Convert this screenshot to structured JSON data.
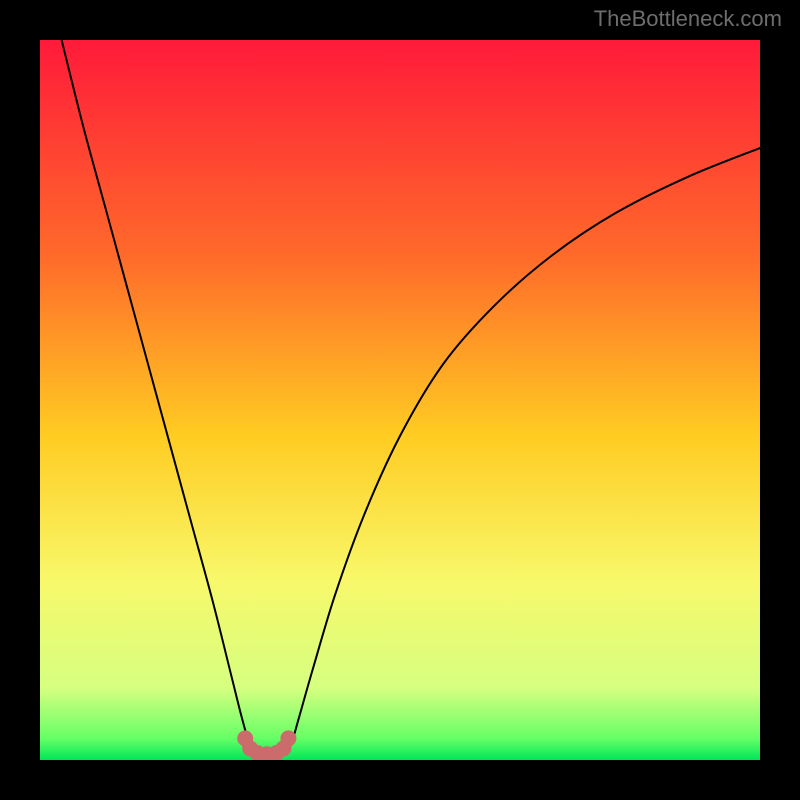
{
  "watermark": "TheBottleneck.com",
  "chart_data": {
    "type": "line",
    "title": "",
    "xlabel": "",
    "ylabel": "",
    "xlim": [
      0,
      100
    ],
    "ylim": [
      0,
      100
    ],
    "background": {
      "type": "vertical-gradient",
      "stops": [
        {
          "pos": 0,
          "color": "#ff1a3a"
        },
        {
          "pos": 30,
          "color": "#ff6a2a"
        },
        {
          "pos": 55,
          "color": "#ffcc22"
        },
        {
          "pos": 75,
          "color": "#f8f86a"
        },
        {
          "pos": 90,
          "color": "#d6ff80"
        },
        {
          "pos": 97,
          "color": "#66ff66"
        },
        {
          "pos": 100,
          "color": "#00e658"
        }
      ]
    },
    "series": [
      {
        "name": "left-branch",
        "x": [
          3,
          6,
          9,
          12,
          15,
          18,
          21,
          24,
          26.5,
          28,
          29,
          29.7
        ],
        "y": [
          100,
          88,
          77,
          66,
          55,
          44,
          33,
          22,
          12,
          6,
          2.5,
          0.9
        ],
        "color": "#000000",
        "width": 2
      },
      {
        "name": "right-branch",
        "x": [
          34.3,
          35,
          36,
          38,
          41,
          45,
          50,
          56,
          63,
          71,
          80,
          90,
          100
        ],
        "y": [
          0.9,
          2.5,
          6,
          13,
          23,
          34,
          45,
          55,
          63,
          70,
          76,
          81,
          85
        ],
        "color": "#000000",
        "width": 2
      },
      {
        "name": "valley-highlight",
        "x": [
          28.5,
          29.2,
          30.2,
          31.5,
          32.8,
          33.8,
          34.5
        ],
        "y": [
          3.0,
          1.6,
          0.95,
          0.8,
          0.95,
          1.6,
          3.0
        ],
        "color": "#cc6b6b",
        "width": 12,
        "markers": true,
        "marker_r": 8
      }
    ]
  }
}
